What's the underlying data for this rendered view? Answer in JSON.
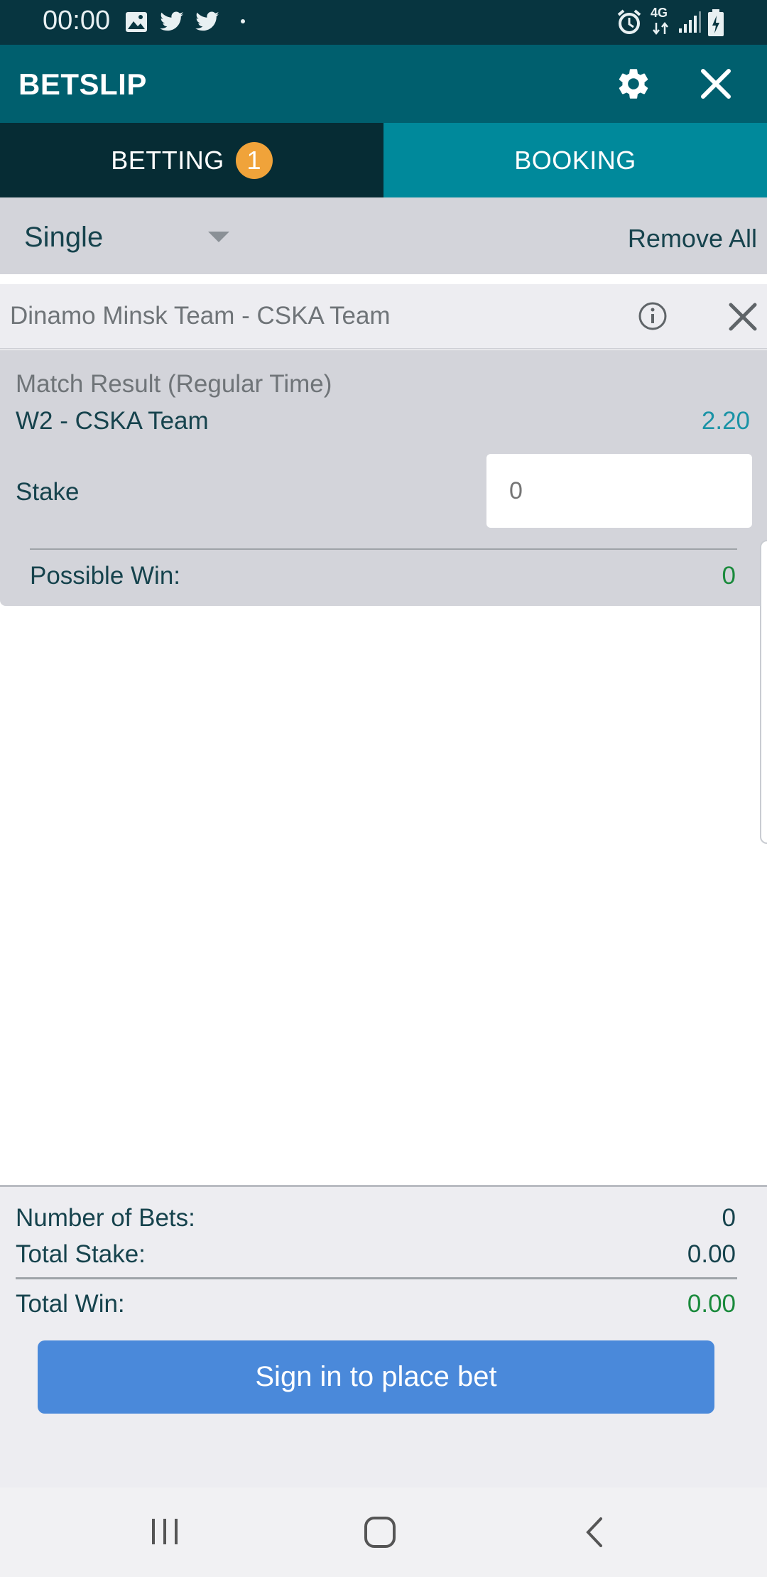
{
  "status_bar": {
    "time": "00:00",
    "left_icons": [
      "image-icon",
      "twitter-icon",
      "twitter-icon",
      "dot-icon"
    ],
    "right_icons": [
      "alarm-icon",
      "4g-icon",
      "signal-icon",
      "battery-charging-icon"
    ],
    "network_label": "4G"
  },
  "app_bar": {
    "title": "BETSLIP",
    "icons": [
      "gear-icon",
      "close-icon"
    ]
  },
  "tabs": {
    "betting": {
      "label": "BETTING",
      "badge": "1"
    },
    "booking": {
      "label": "BOOKING"
    }
  },
  "bet_type": {
    "selected": "Single",
    "remove_all_label": "Remove All"
  },
  "bet": {
    "event": "Dinamo Minsk Team - CSKA Team",
    "market": "Match Result (Regular Time)",
    "selection": "W2  - CSKA Team",
    "odds": "2.20",
    "stake_label": "Stake",
    "stake_placeholder": "0",
    "possible_win_label": "Possible Win:",
    "possible_win_value": "0"
  },
  "summary": {
    "number_of_bets_label": "Number of Bets:",
    "number_of_bets_value": "0",
    "total_stake_label": "Total Stake:",
    "total_stake_value": "0.00",
    "total_win_label": "Total  Win:",
    "total_win_value": "0.00",
    "sign_in_button": "Sign in to place bet"
  },
  "colors": {
    "status_bar": "#073540",
    "app_bar": "#005f6e",
    "tab_active": "#062c34",
    "tab_inactive": "#00899b",
    "badge": "#f0a33a",
    "odds": "#1a93a6",
    "win_green": "#1a8a3c",
    "primary_button": "#4a89da"
  },
  "nav_bar": {
    "icons": [
      "recent-apps-icon",
      "home-icon",
      "back-icon"
    ]
  }
}
